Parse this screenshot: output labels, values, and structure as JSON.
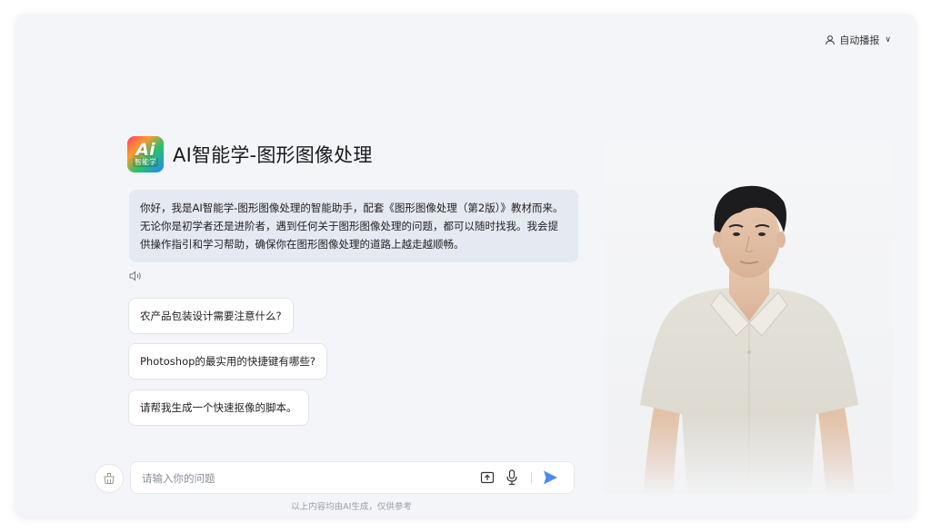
{
  "topbar": {
    "auto_play_label": "自动播报"
  },
  "header": {
    "logo_text": "Ai",
    "logo_subtext": "智能学",
    "title": "AI智能学-图形图像处理"
  },
  "greeting": "你好，我是AI智能学-图形图像处理的智能助手，配套《图形图像处理（第2版）》教材而来。无论你是初学者还是进阶者，遇到任何关于图形图像处理的问题，都可以随时找我。我会提供操作指引和学习帮助，确保你在图形图像处理的道路上越走越顺畅。",
  "suggestions": [
    "农产品包装设计需要注意什么?",
    "Photoshop的最实用的快捷键有哪些?",
    "请帮我生成一个快速抠像的脚本。"
  ],
  "input": {
    "placeholder": "请输入你的问题",
    "value": ""
  },
  "disclaimer": "以上内容均由AI生成，仅供参考",
  "colors": {
    "accent": "#4b8bf5",
    "card_bg": "#f3f5f9",
    "bubble_bg": "#e5e9f1"
  }
}
